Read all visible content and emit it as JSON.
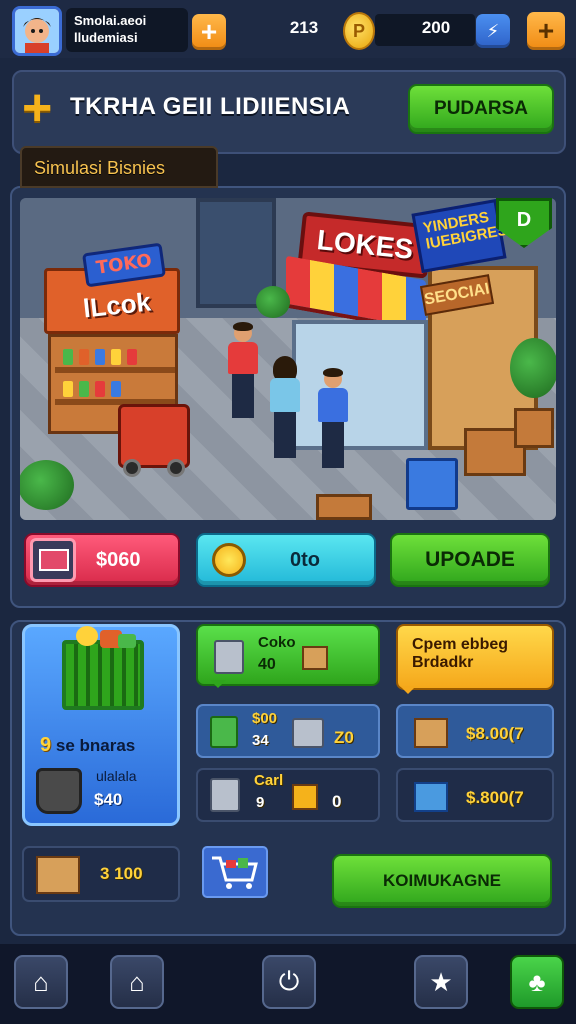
{
  "player": {
    "name_line1": "Smolai.aeoi",
    "name_line2": "lludemiasi"
  },
  "top": {
    "gems": "213",
    "coins": "200",
    "add_symbol": "+",
    "coin_symbol": "P"
  },
  "banner": {
    "title": "TKRHA GEII LIDIIENSIA",
    "button": "PUDARSA"
  },
  "section": {
    "tab_label": "Simulasi Bisnies"
  },
  "scene": {
    "kiosk_sign_top": "TOKO",
    "kiosk_sign_mid": "lLcok",
    "store_sign": "LOKES",
    "side_sign": "YINDERS IUEBIGRESS",
    "side_price": "SEOCIAI",
    "badge": "D"
  },
  "actions": {
    "red_value": "$060",
    "cyan_value": "0to",
    "upgrade": "UPOADE"
  },
  "shop_card": {
    "count": "9",
    "label": "se bnaras",
    "sub_label": "ulalala",
    "sub_value": "$40"
  },
  "green_card": {
    "label": "Coko",
    "value": "40"
  },
  "orange_card": {
    "line1": "Cpem ebbeg",
    "line2": "Brdadkr"
  },
  "rows": {
    "r1_top": "$00",
    "r1_left": "34",
    "r1_right": "Z0",
    "r2_top": "Carl",
    "r2_left": "9",
    "r2_right": "0",
    "price1": "$8.00(7",
    "price2": "$.800(7"
  },
  "bottom": {
    "value": "3 100",
    "main_button": "KOIMUKAGNE"
  },
  "nav": [
    "home-icon",
    "house-icon",
    "power-icon",
    "star-icon",
    "clover-icon"
  ]
}
